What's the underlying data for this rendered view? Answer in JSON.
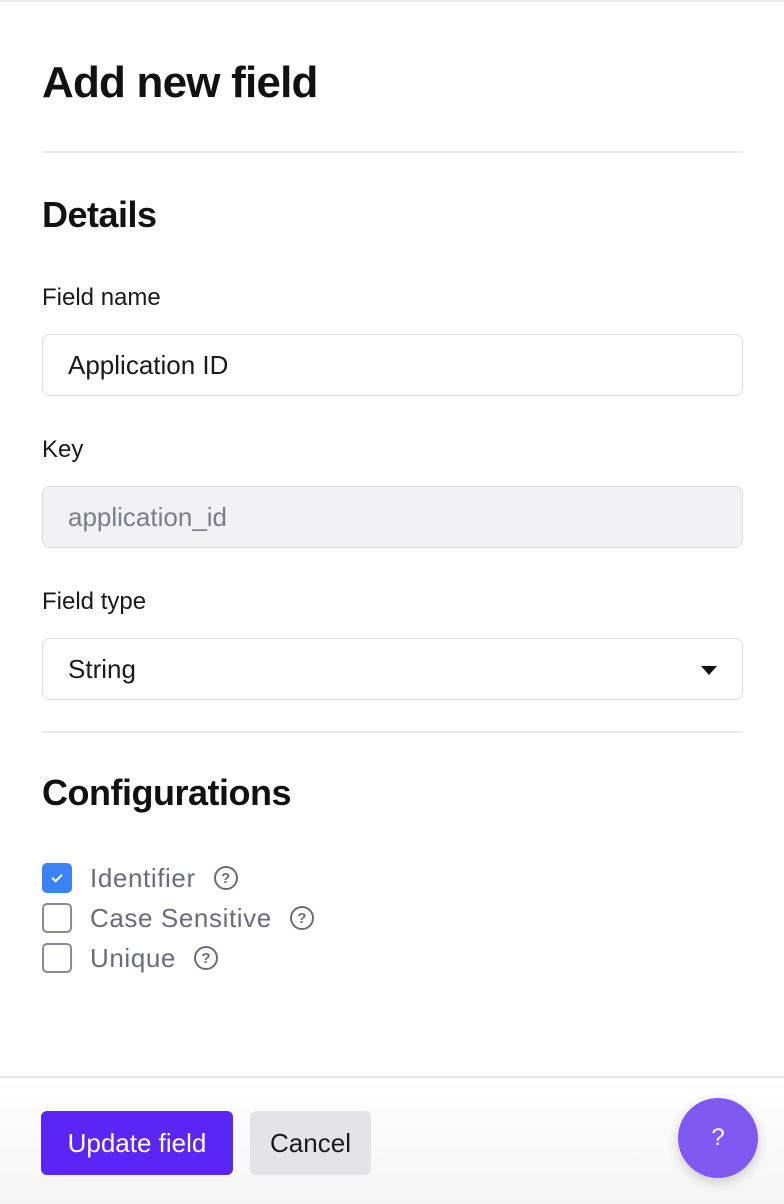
{
  "header": {
    "title": "Add new field"
  },
  "details": {
    "heading": "Details",
    "field_name": {
      "label": "Field name",
      "value": "Application ID"
    },
    "key": {
      "label": "Key",
      "value": "application_id",
      "disabled": true
    },
    "field_type": {
      "label": "Field type",
      "selected": "String"
    }
  },
  "configurations": {
    "heading": "Configurations",
    "options": [
      {
        "label": "Identifier",
        "checked": true
      },
      {
        "label": "Case Sensitive",
        "checked": false
      },
      {
        "label": "Unique",
        "checked": false
      }
    ],
    "help_glyph": "?"
  },
  "footer": {
    "update_label": "Update field",
    "cancel_label": "Cancel"
  },
  "help_fab": {
    "label": "?"
  },
  "colors": {
    "primary": "#5b25f5",
    "checkbox_checked": "#3b82f6",
    "fab": "#8059f3"
  }
}
